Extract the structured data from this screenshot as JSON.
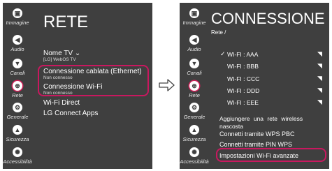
{
  "left_panel": {
    "sidebar": [
      {
        "icon": "image-icon",
        "glyph": "▣",
        "label": "Immagine"
      },
      {
        "icon": "audio-icon",
        "glyph": "◀",
        "label": "Audio"
      },
      {
        "icon": "channels-icon",
        "glyph": "▼",
        "label": "Canali"
      },
      {
        "icon": "network-icon",
        "glyph": "⊛",
        "label": "Rete"
      },
      {
        "icon": "general-icon",
        "glyph": "⚙",
        "label": "Generale"
      },
      {
        "icon": "lock-icon",
        "glyph": "▲",
        "label": "Sicurezza"
      },
      {
        "icon": "accessibility-icon",
        "glyph": "✺",
        "label": "Accessibilità"
      }
    ],
    "title": "RETE",
    "items": {
      "tv_name": {
        "label": "Nome TV",
        "chevron": "⌄",
        "sub": "[LG] WebOS TV"
      },
      "wired": {
        "label": "Connessione cablata (Ethernet)",
        "sub": "Non connesso"
      },
      "wifi": {
        "label": "Connessione Wi-Fi",
        "sub": "Non connesso"
      },
      "wifi_direct": {
        "label": "Wi-Fi Direct"
      },
      "lg_connect": {
        "label": "LG Connect Apps"
      }
    }
  },
  "right_panel": {
    "sidebar": [
      {
        "icon": "image-icon",
        "glyph": "▣",
        "label": "Immagine"
      },
      {
        "icon": "audio-icon",
        "glyph": "◀",
        "label": "Audio"
      },
      {
        "icon": "channels-icon",
        "glyph": "▼",
        "label": "Canali"
      },
      {
        "icon": "network-icon",
        "glyph": "⊛",
        "label": "Rete"
      },
      {
        "icon": "general-icon",
        "glyph": "⚙",
        "label": "Generale"
      },
      {
        "icon": "lock-icon",
        "glyph": "▲",
        "label": "Sicurezza"
      },
      {
        "icon": "accessibility-icon",
        "glyph": "✺",
        "label": "Accessibilità"
      }
    ],
    "title": "CONNESSIONE WI-F",
    "breadcrumb": "Rete /",
    "networks": [
      {
        "name": "WI-FI : AAA",
        "check": "✓",
        "signal": "◥"
      },
      {
        "name": "WI-FI : BBB",
        "check": "",
        "signal": "◥"
      },
      {
        "name": "WI-FI : CCC",
        "check": "",
        "signal": "◥"
      },
      {
        "name": "WI-FI : DDD",
        "check": "",
        "signal": "◥"
      },
      {
        "name": "WI-FI : EEE",
        "check": "",
        "signal": "◥"
      }
    ],
    "add_network": "Aggiungere una rete wireless nascosta",
    "wps_pbc": "Connetti tramite WPS PBC",
    "wps_pin": "Connetti tramite PIN WPS",
    "advanced": "Impostazioni Wi-Fi avanzate"
  },
  "arrow_glyph": "⇨",
  "colors": {
    "panel": "#3f3f3f",
    "highlight": "#c9185f",
    "text": "#ffffff"
  }
}
